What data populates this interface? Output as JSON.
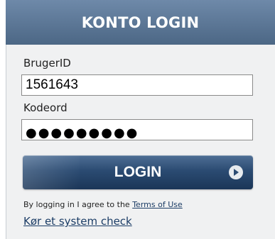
{
  "header": {
    "title": "KONTO LOGIN"
  },
  "form": {
    "userid_label": "BrugerID",
    "userid_value": "1561643",
    "password_label": "Kodeord",
    "password_mask": "●●●●●●●●●",
    "login_button": "LOGIN"
  },
  "footer": {
    "agree_text": "By logging in I agree to the",
    "terms_link": "Terms of Use",
    "system_check_link": "Kør et system check"
  },
  "icons": {
    "login_arrow": "arrow-right-icon"
  },
  "colors": {
    "header": "#5a7596",
    "button": "#2b4b72",
    "link": "#1c3d66",
    "panel_bg": "#f0f1f2"
  }
}
